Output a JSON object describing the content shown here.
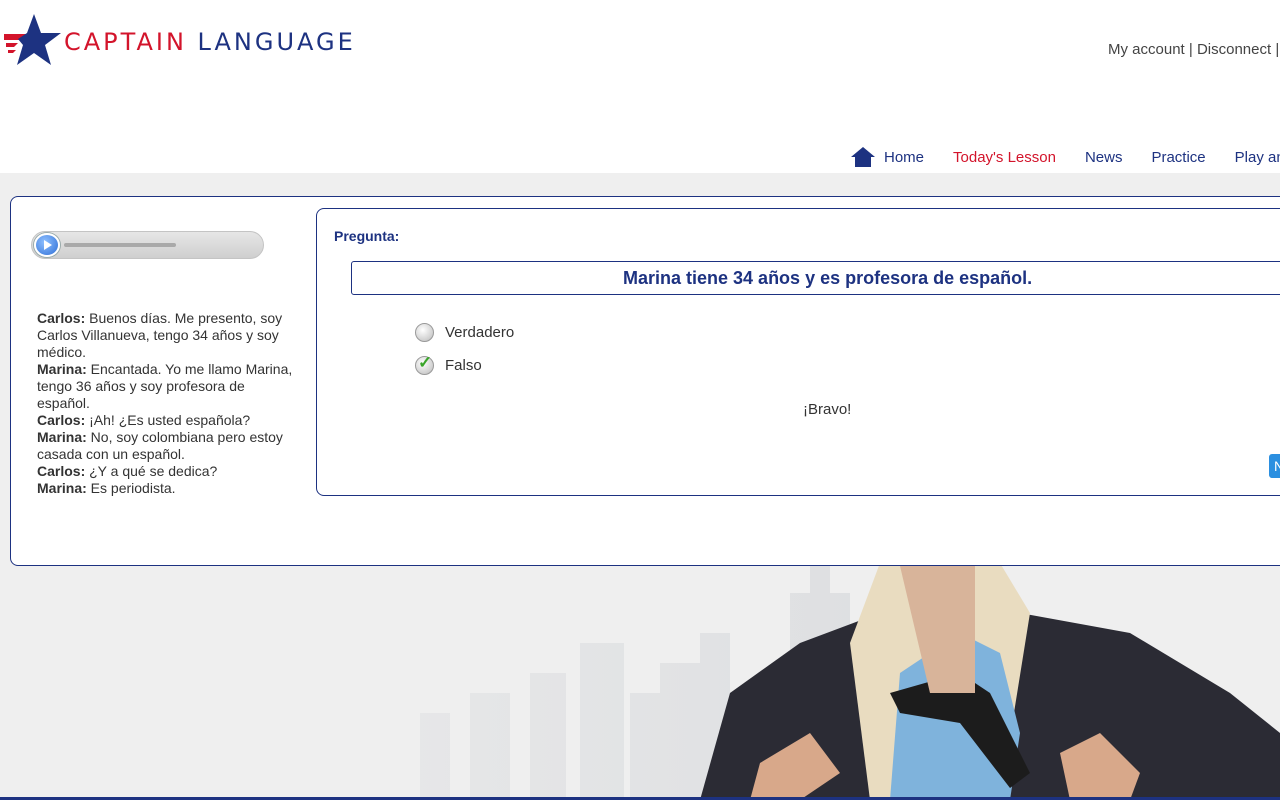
{
  "brand": {
    "part1": "CAPTAIN",
    "part2": "LANGUAGE"
  },
  "account": {
    "my_account": "My account",
    "separator": "|",
    "disconnect": "Disconnect"
  },
  "nav": {
    "items": [
      {
        "label": "Home"
      },
      {
        "label": "Today's Lesson"
      },
      {
        "label": "News"
      },
      {
        "label": "Practice"
      },
      {
        "label": "Play and"
      }
    ]
  },
  "transcript": [
    {
      "speaker": "Carlos:",
      "text": " Buenos días. Me presento, soy Carlos Villanueva, tengo 34 años y soy médico."
    },
    {
      "speaker": "Marina:",
      "text": " Encantada. Yo me llamo Marina, tengo 36 años y soy profesora de español."
    },
    {
      "speaker": "Carlos:",
      "text": " ¡Ah! ¿Es usted española?"
    },
    {
      "speaker": "Marina:",
      "text": " No, soy colombiana pero estoy casada con un español."
    },
    {
      "speaker": "Carlos:",
      "text": " ¿Y a qué se dedica?"
    },
    {
      "speaker": "Marina:",
      "text": " Es periodista."
    }
  ],
  "quiz": {
    "label": "Pregunta:",
    "question": "Marina tiene 34 años y es profesora de español.",
    "options": [
      {
        "label": "Verdadero",
        "selected": false
      },
      {
        "label": "Falso",
        "selected": true
      }
    ],
    "feedback": "¡Bravo!",
    "next_label": "N"
  },
  "colors": {
    "brand_blue": "#1d3281",
    "brand_red": "#d3142b",
    "button_blue": "#2b8fe0",
    "check_green": "#3aa52a"
  }
}
